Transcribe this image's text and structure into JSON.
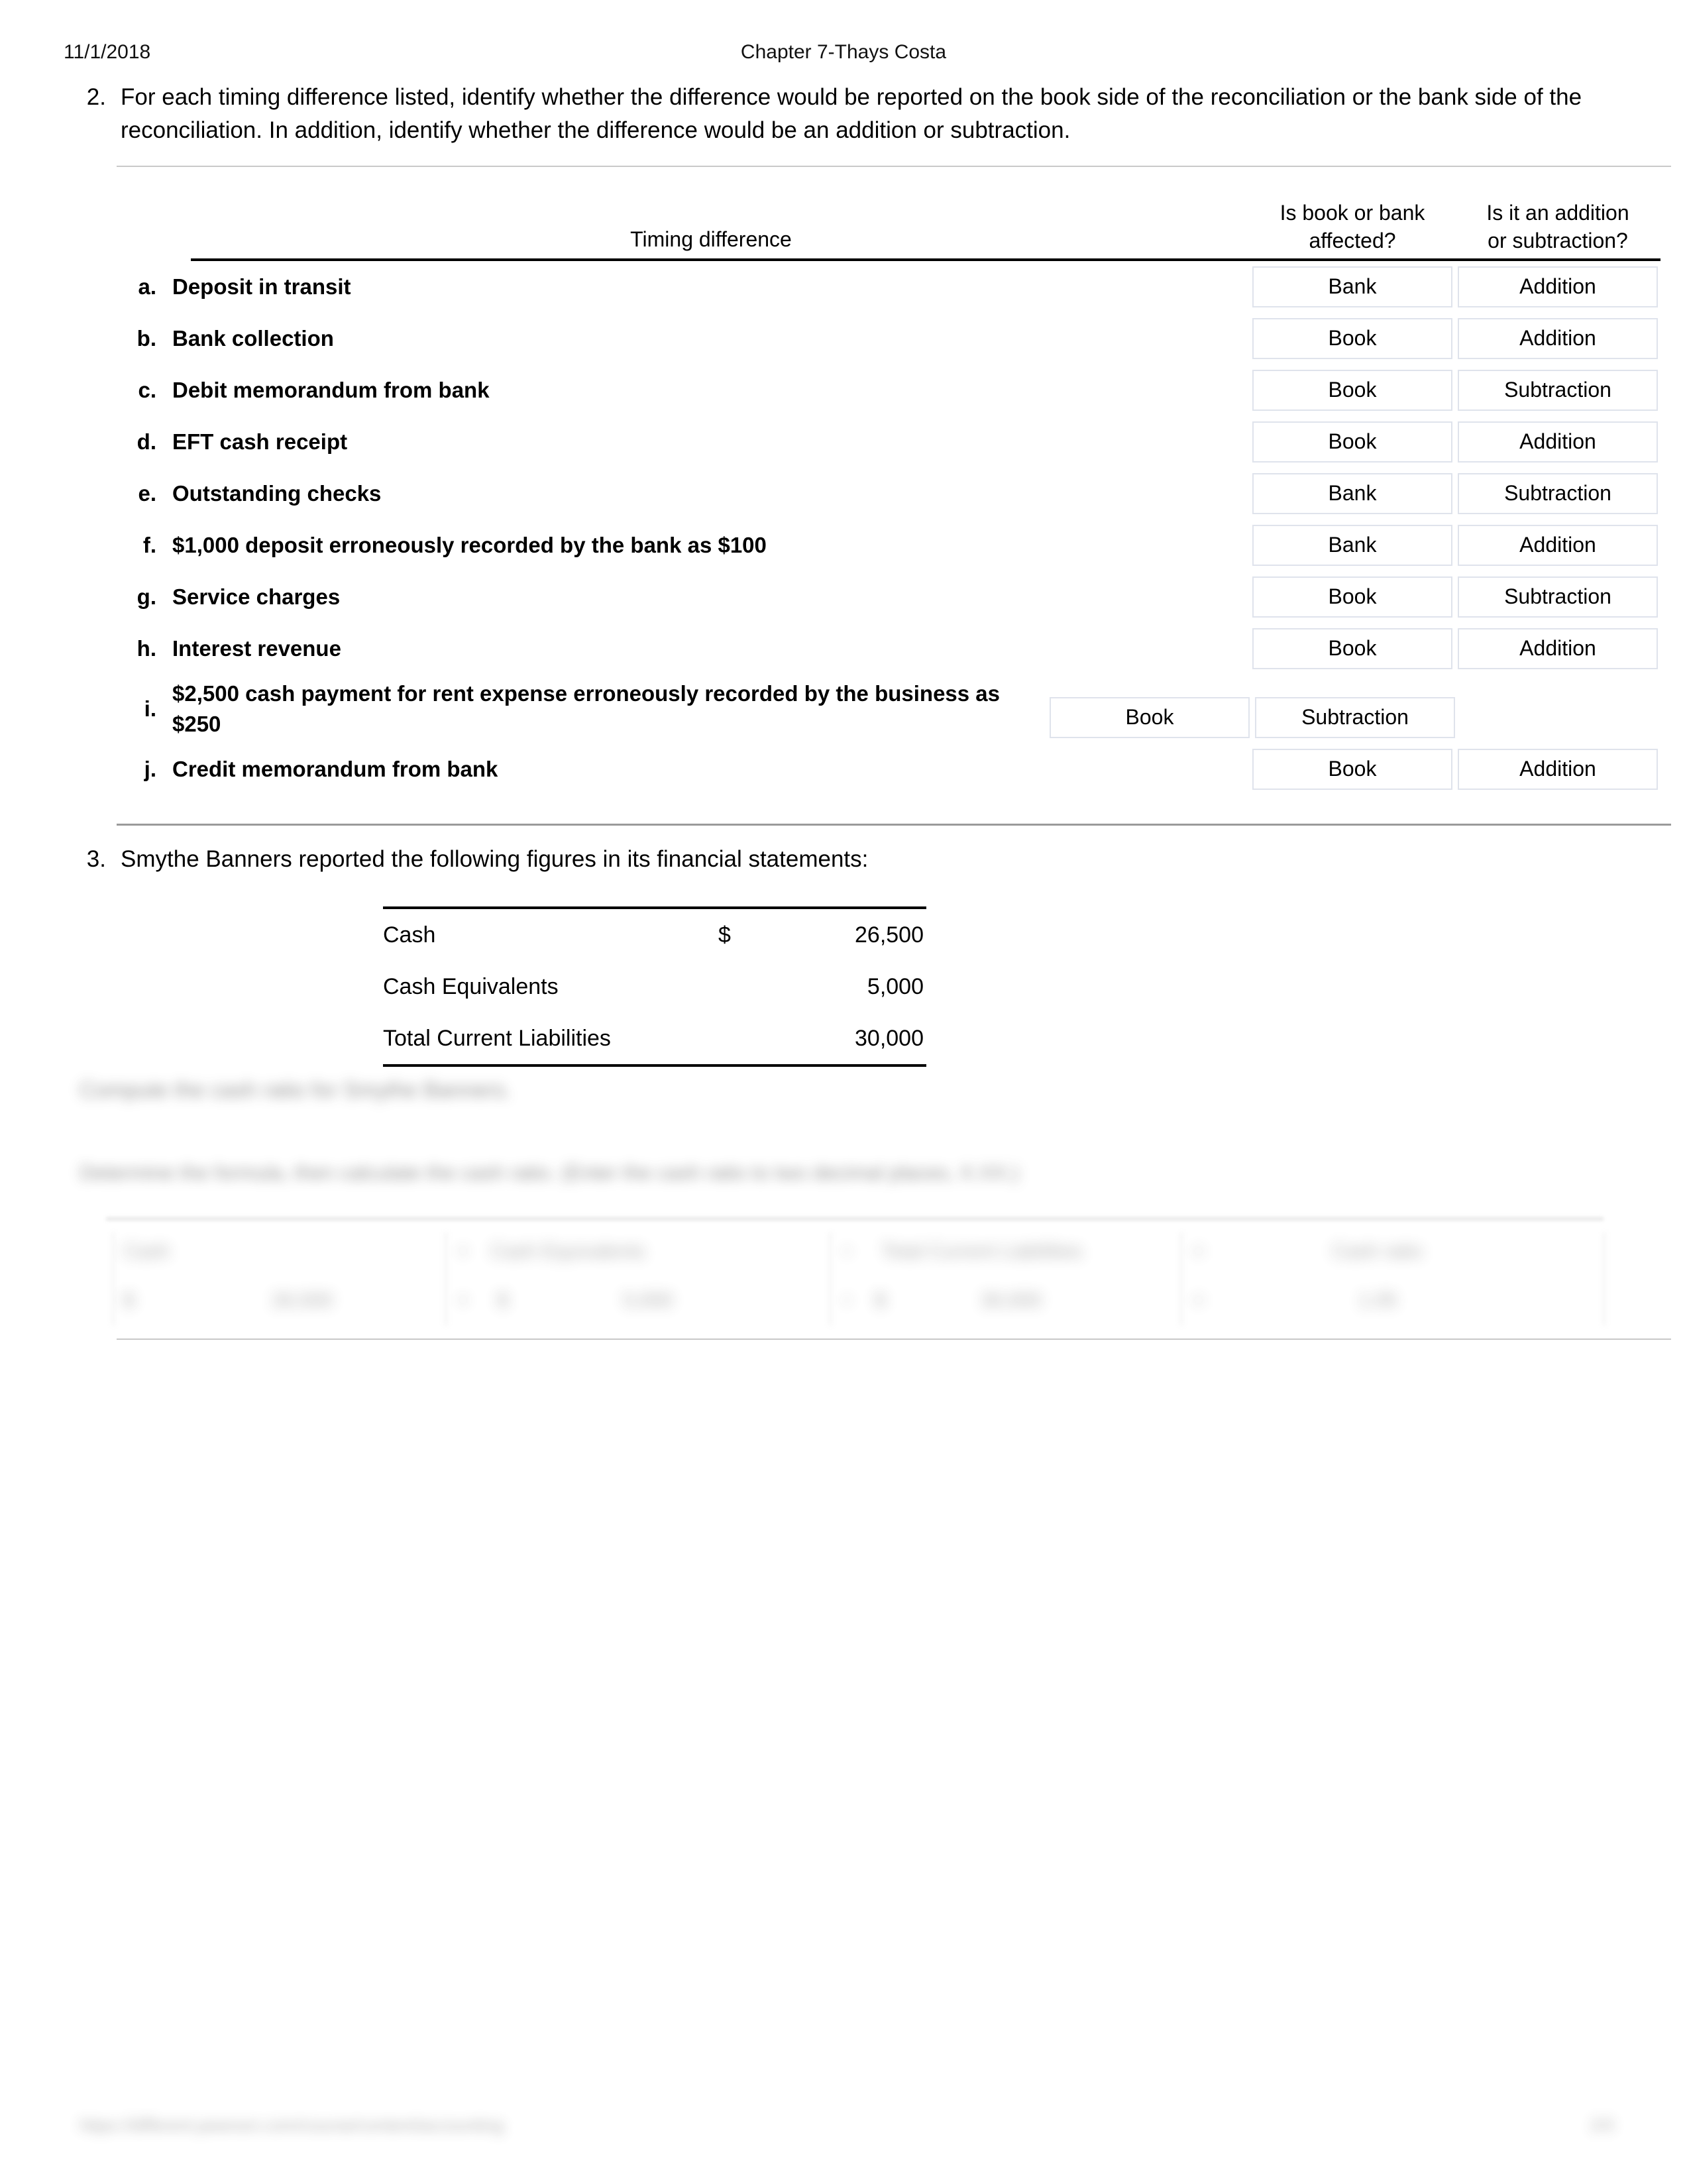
{
  "header": {
    "date": "11/1/2018",
    "title": "Chapter 7-Thays Costa"
  },
  "question2": {
    "number": "2.",
    "text": "For each timing difference listed, identify whether the difference would be reported on the book side of the reconciliation or the bank side of the reconciliation. In addition, identify whether the difference would be an addition or subtraction.",
    "columns": {
      "timing_difference": "Timing difference",
      "book_or_bank": "Is book or bank affected?",
      "addition_or_subtraction": "Is it an addition or subtraction?"
    },
    "rows": [
      {
        "letter": "a.",
        "difference": "Deposit in transit",
        "affected": "Bank",
        "operation": "Addition"
      },
      {
        "letter": "b.",
        "difference": "Bank collection",
        "affected": "Book",
        "operation": "Addition"
      },
      {
        "letter": "c.",
        "difference": "Debit memorandum from bank",
        "affected": "Book",
        "operation": "Subtraction"
      },
      {
        "letter": "d.",
        "difference": "EFT cash receipt",
        "affected": "Book",
        "operation": "Addition"
      },
      {
        "letter": "e.",
        "difference": "Outstanding checks",
        "affected": "Bank",
        "operation": "Subtraction"
      },
      {
        "letter": "f.",
        "difference": "$1,000 deposit erroneously recorded by the bank as $100",
        "affected": "Bank",
        "operation": "Addition"
      },
      {
        "letter": "g.",
        "difference": "Service charges",
        "affected": "Book",
        "operation": "Subtraction"
      },
      {
        "letter": "h.",
        "difference": "Interest revenue",
        "affected": "Book",
        "operation": "Addition"
      },
      {
        "letter": "i.",
        "difference": "$2,500 cash payment for rent expense erroneously recorded by the business as $250",
        "affected": "Book",
        "operation": "Subtraction"
      },
      {
        "letter": "j.",
        "difference": "Credit memorandum from bank",
        "affected": "Book",
        "operation": "Addition"
      }
    ]
  },
  "question3": {
    "number": "3.",
    "text": "Smythe Banners reported the following figures in its financial statements:",
    "figures": [
      {
        "label": "Cash",
        "currency": "$",
        "value": "26,500"
      },
      {
        "label": "Cash Equivalents",
        "currency": "",
        "value": "5,000"
      },
      {
        "label": "Total Current Liabilities",
        "currency": "",
        "value": "30,000"
      }
    ],
    "obscured": {
      "prompt_line_1": "Compute the cash ratio for Smythe Banners.",
      "prompt_line_2": "Determine the formula, then calculate the cash ratio. (Enter the cash ratio to two decimal places, X.XX.)",
      "worksheet_headers": [
        "Cash",
        "+",
        "Cash Equivalents",
        "÷",
        "Total Current Liabilities",
        "=",
        "Cash ratio"
      ],
      "worksheet_values": [
        "$",
        "26,500",
        "+",
        "$",
        "5,000",
        "÷",
        "$",
        "30,000",
        "=",
        "1.05"
      ]
    }
  },
  "footer": {
    "left": "https://different.pearson.com/course/content/accounting",
    "right": "2/3"
  }
}
